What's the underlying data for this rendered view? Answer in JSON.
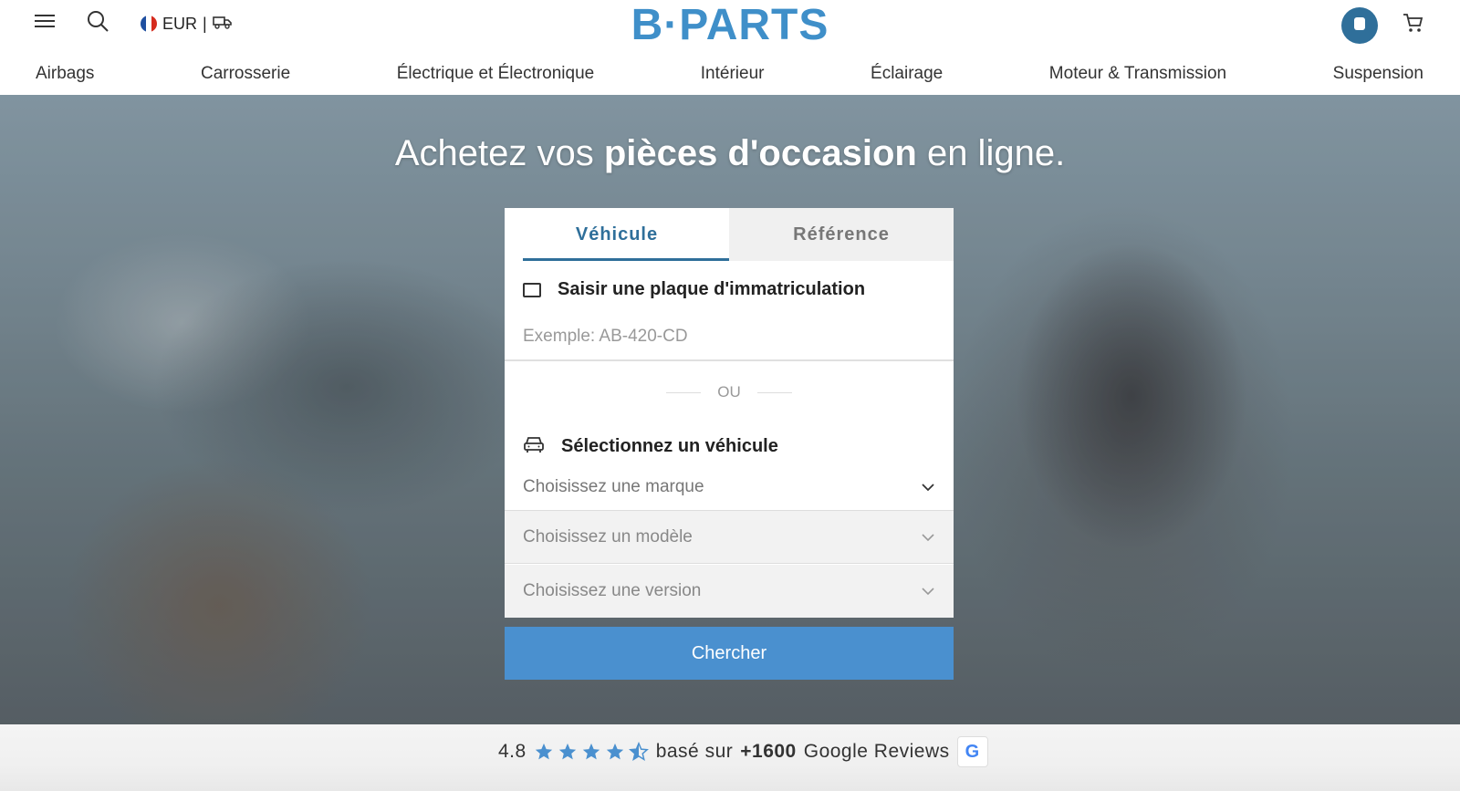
{
  "header": {
    "currency": "EUR",
    "currency_separator": "|",
    "logo_text": "B·PARTS",
    "logo_color": "#3f8fc9"
  },
  "nav": {
    "categories": [
      "Airbags",
      "Carrosserie",
      "Électrique et Électronique",
      "Intérieur",
      "Éclairage",
      "Moteur & Transmission",
      "Suspension"
    ]
  },
  "hero": {
    "title_part1": "Achetez vos",
    "title_bold": "pièces d'occasion",
    "title_part2": "en ligne."
  },
  "search": {
    "tabs": [
      "Véhicule",
      "Référence"
    ],
    "active_tab": "Véhicule",
    "plate_label": "Saisir une plaque d'immatriculation",
    "plate_placeholder": "Exemple: AB-420-CD",
    "or_text": "OU",
    "vehicle_label": "Sélectionnez un véhicule",
    "brand_placeholder": "Choisissez une marque",
    "model_placeholder": "Choisissez un modèle",
    "version_placeholder": "Choisissez une version",
    "submit_label": "Chercher",
    "accent_color": "#4a90cf"
  },
  "reviews": {
    "rating": "4.8",
    "stars_value": 4.5,
    "text_before": "basé sur",
    "count": "+1600",
    "text_after": "Google Reviews",
    "badge_letter": "G"
  }
}
